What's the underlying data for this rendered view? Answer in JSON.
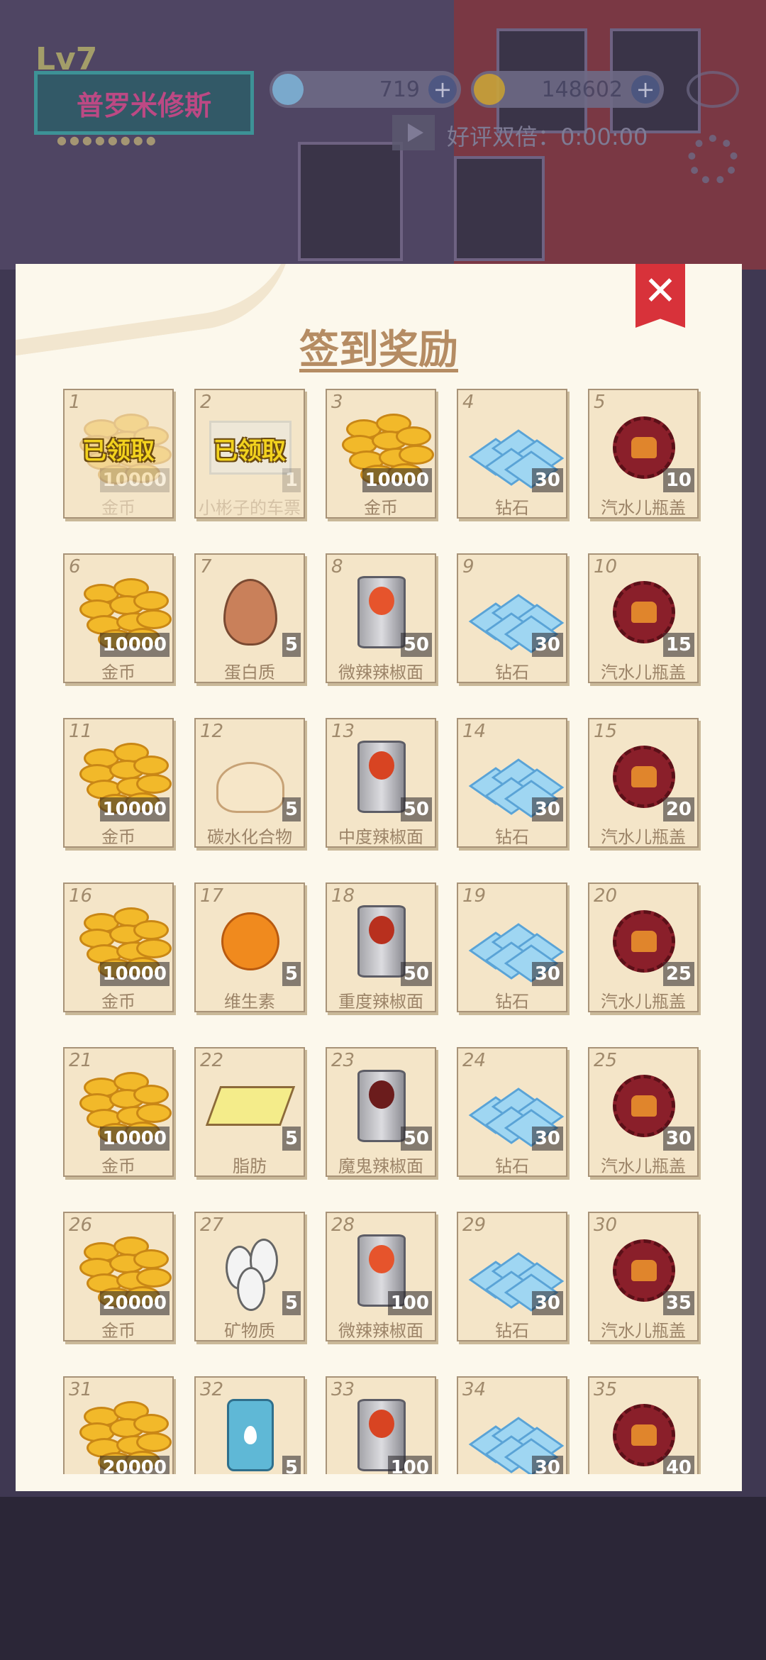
{
  "hud": {
    "level": "Lv7",
    "player_name": "普罗米修斯",
    "diamonds": "719",
    "coins": "148602",
    "bonus_label": "好评双倍：0:00:00"
  },
  "dialog": {
    "title": "签到奖励",
    "close_label": "✕",
    "claimed_label": "已领取"
  },
  "rewards": [
    {
      "day": "1",
      "name": "金币",
      "qty": "10000",
      "kind": "coins",
      "claimed": true
    },
    {
      "day": "2",
      "name": "小彬子的车票",
      "qty": "1",
      "kind": "ticket",
      "claimed": true
    },
    {
      "day": "3",
      "name": "金币",
      "qty": "10000",
      "kind": "coins",
      "claimed": false
    },
    {
      "day": "4",
      "name": "钻石",
      "qty": "30",
      "kind": "diamond",
      "claimed": false
    },
    {
      "day": "5",
      "name": "汽水儿瓶盖",
      "qty": "10",
      "kind": "cap",
      "claimed": false
    },
    {
      "day": "6",
      "name": "金币",
      "qty": "10000",
      "kind": "coins",
      "claimed": false
    },
    {
      "day": "7",
      "name": "蛋白质",
      "qty": "5",
      "kind": "egg",
      "claimed": false
    },
    {
      "day": "8",
      "name": "微辣辣椒面",
      "qty": "50",
      "kind": "can1",
      "claimed": false
    },
    {
      "day": "9",
      "name": "钻石",
      "qty": "30",
      "kind": "diamond",
      "claimed": false
    },
    {
      "day": "10",
      "name": "汽水儿瓶盖",
      "qty": "15",
      "kind": "cap",
      "claimed": false
    },
    {
      "day": "11",
      "name": "金币",
      "qty": "10000",
      "kind": "coins",
      "claimed": false
    },
    {
      "day": "12",
      "name": "碳水化合物",
      "qty": "5",
      "kind": "bun",
      "claimed": false
    },
    {
      "day": "13",
      "name": "中度辣椒面",
      "qty": "50",
      "kind": "can2",
      "claimed": false
    },
    {
      "day": "14",
      "name": "钻石",
      "qty": "30",
      "kind": "diamond",
      "claimed": false
    },
    {
      "day": "15",
      "name": "汽水儿瓶盖",
      "qty": "20",
      "kind": "cap",
      "claimed": false
    },
    {
      "day": "16",
      "name": "金币",
      "qty": "10000",
      "kind": "coins",
      "claimed": false
    },
    {
      "day": "17",
      "name": "维生素",
      "qty": "5",
      "kind": "orange",
      "claimed": false
    },
    {
      "day": "18",
      "name": "重度辣椒面",
      "qty": "50",
      "kind": "can3",
      "claimed": false
    },
    {
      "day": "19",
      "name": "钻石",
      "qty": "30",
      "kind": "diamond",
      "claimed": false
    },
    {
      "day": "20",
      "name": "汽水儿瓶盖",
      "qty": "25",
      "kind": "cap",
      "claimed": false
    },
    {
      "day": "21",
      "name": "金币",
      "qty": "10000",
      "kind": "coins",
      "claimed": false
    },
    {
      "day": "22",
      "name": "脂肪",
      "qty": "5",
      "kind": "butter",
      "claimed": false
    },
    {
      "day": "23",
      "name": "魔鬼辣椒面",
      "qty": "50",
      "kind": "can4",
      "claimed": false
    },
    {
      "day": "24",
      "name": "钻石",
      "qty": "30",
      "kind": "diamond",
      "claimed": false
    },
    {
      "day": "25",
      "name": "汽水儿瓶盖",
      "qty": "30",
      "kind": "cap",
      "claimed": false
    },
    {
      "day": "26",
      "name": "金币",
      "qty": "20000",
      "kind": "coins",
      "claimed": false
    },
    {
      "day": "27",
      "name": "矿物质",
      "qty": "5",
      "kind": "seeds",
      "claimed": false
    },
    {
      "day": "28",
      "name": "微辣辣椒面",
      "qty": "100",
      "kind": "can1",
      "claimed": false
    },
    {
      "day": "29",
      "name": "钻石",
      "qty": "30",
      "kind": "diamond",
      "claimed": false
    },
    {
      "day": "30",
      "name": "汽水儿瓶盖",
      "qty": "35",
      "kind": "cap",
      "claimed": false
    },
    {
      "day": "31",
      "name": "金币",
      "qty": "20000",
      "kind": "coins",
      "claimed": false
    },
    {
      "day": "32",
      "name": "",
      "qty": "5",
      "kind": "bottle",
      "claimed": false
    },
    {
      "day": "33",
      "name": "",
      "qty": "100",
      "kind": "can2",
      "claimed": false
    },
    {
      "day": "34",
      "name": "",
      "qty": "30",
      "kind": "diamond",
      "claimed": false
    },
    {
      "day": "35",
      "name": "",
      "qty": "40",
      "kind": "cap",
      "claimed": false
    }
  ],
  "colors": {
    "panel_bg": "#fcf8ec",
    "cell_bg": "#f4e5c8",
    "title": "#b58c63",
    "close_ribbon": "#d8323a",
    "claimed_stamp": "#f2d21e"
  },
  "icons": {
    "coins": "gold-coins-icon",
    "ticket": "ticket-icon",
    "diamond": "diamond-icon",
    "cap": "bottle-cap-icon",
    "egg": "egg-icon",
    "can1": "chili-can-icon",
    "can2": "chili-can-icon",
    "can3": "chili-can-icon",
    "can4": "chili-can-icon",
    "bun": "steamed-bun-icon",
    "orange": "orange-icon",
    "butter": "butter-icon",
    "seeds": "seeds-icon",
    "bottle": "water-bottle-icon"
  }
}
